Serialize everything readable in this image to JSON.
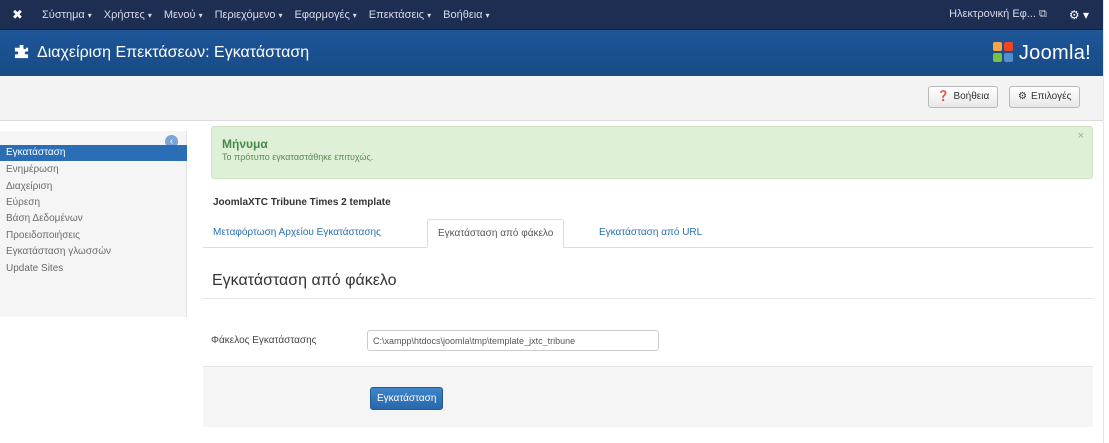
{
  "topnav": {
    "brand_icon": "joomla-x-icon",
    "menu": [
      {
        "label": "Σύστημα"
      },
      {
        "label": "Χρήστες"
      },
      {
        "label": "Μενού"
      },
      {
        "label": "Περιεχόμενο"
      },
      {
        "label": "Εφαρμογές"
      },
      {
        "label": "Επεκτάσεις"
      },
      {
        "label": "Βοήθεια"
      }
    ],
    "caret": "▾",
    "user_label": "Ηλεκτρονική Εφ... ⧉",
    "settings_icon": "⚙ ▾"
  },
  "header": {
    "title": "Διαχείριση Επεκτάσεων: Εγκατάσταση",
    "icon": "puzzle-icon",
    "logo_text": "Joomla!"
  },
  "toolbar": {
    "help_label": "Βοήθεια",
    "options_label": "Επιλογές"
  },
  "sidebar": {
    "items": [
      {
        "label": "Εγκατάσταση",
        "active": true
      },
      {
        "label": "Ενημέρωση"
      },
      {
        "label": "Διαχείριση"
      },
      {
        "label": "Εύρεση"
      },
      {
        "label": "Βάση Δεδομένων"
      },
      {
        "label": "Προειδοποιήσεις"
      },
      {
        "label": "Εγκατάσταση γλωσσών"
      },
      {
        "label": "Update Sites"
      }
    ]
  },
  "alert": {
    "heading": "Μήνυμα",
    "body": "Το πρότυπο εγκαταστάθηκε επιτυχώς.",
    "close": "×"
  },
  "content": {
    "subtitle": "JoomlaXTC Tribune Times 2 template",
    "tabs": [
      {
        "label": "Μεταφόρτωση Αρχείου Εγκατάστασης"
      },
      {
        "label": "Εγκατάσταση από φάκελο",
        "active": true
      },
      {
        "label": "Εγκατάσταση από URL"
      }
    ],
    "section_title": "Εγκατάσταση από φάκελο",
    "folder_label": "Φάκελος Εγκατάστασης",
    "folder_value": "C:\\xampp\\htdocs\\joomla\\tmp\\template_jxtc_tribune",
    "install_button": "Εγκατάσταση"
  },
  "colors": {
    "topbar": "#1e2d52",
    "header": "#1b4c8a",
    "accent": "#2a6fb5",
    "alert_bg": "#dff0d8"
  }
}
